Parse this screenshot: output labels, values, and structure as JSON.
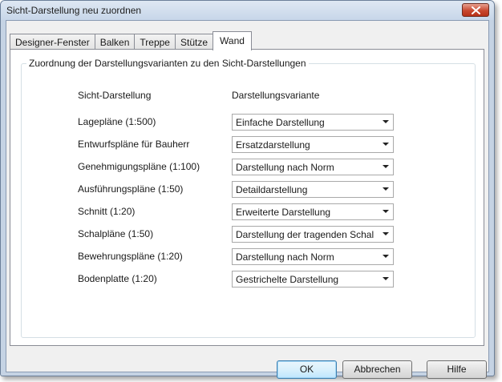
{
  "window": {
    "title": "Sicht-Darstellung neu zuordnen",
    "close_icon": "close-x-icon"
  },
  "tabs": [
    {
      "label": "Designer-Fenster",
      "active": false
    },
    {
      "label": "Balken",
      "active": false
    },
    {
      "label": "Treppe",
      "active": false
    },
    {
      "label": "Stütze",
      "active": false
    },
    {
      "label": "Wand",
      "active": true
    }
  ],
  "group": {
    "title": "Zuordnung der Darstellungsvarianten zu den Sicht-Darstellungen",
    "col_view": "Sicht-Darstellung",
    "col_variant": "Darstellungsvariante",
    "rows": [
      {
        "view": "Lagepläne (1:500)",
        "variant": "Einfache Darstellung"
      },
      {
        "view": "Entwurfspläne für Bauherr",
        "variant": "Ersatzdarstellung"
      },
      {
        "view": "Genehmigungspläne (1:100)",
        "variant": "Darstellung nach Norm"
      },
      {
        "view": "Ausführungspläne (1:50)",
        "variant": "Detaildarstellung"
      },
      {
        "view": "Schnitt (1:20)",
        "variant": "Erweiterte Darstellung"
      },
      {
        "view": "Schalpläne (1:50)",
        "variant": "Darstellung der tragenden Schal"
      },
      {
        "view": "Bewehrungspläne (1:20)",
        "variant": "Darstellung nach Norm"
      },
      {
        "view": "Bodenplatte (1:20)",
        "variant": "Gestrichelte Darstellung"
      }
    ]
  },
  "buttons": {
    "ok": "OK",
    "cancel": "Abbrechen",
    "help": "Hilfe"
  }
}
